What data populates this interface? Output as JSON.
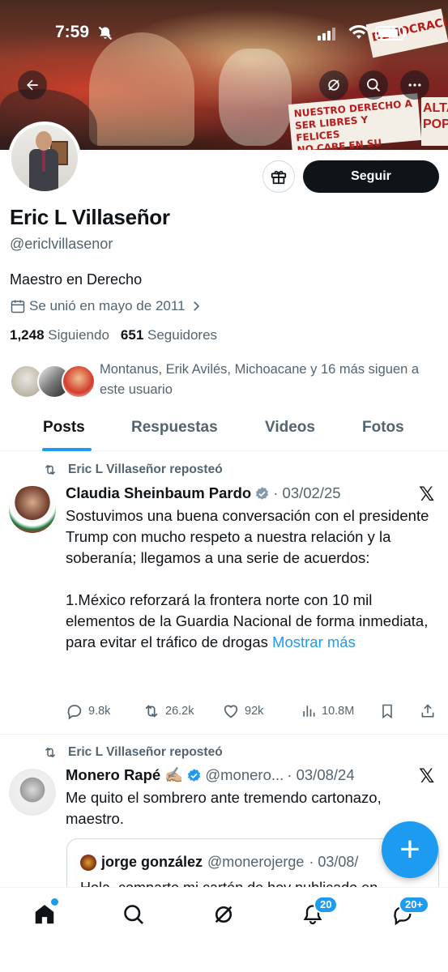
{
  "status_bar": {
    "time": "7:59"
  },
  "banner": {
    "sign_top": "DEMOCRACIA",
    "sign_main_line1": "NUESTRO DERECHO A",
    "sign_main_line2": "SER LIBRES Y FELICES",
    "sign_main_line3": "NO CABE EN SU FRAUDE",
    "sign_right": "ALTA POP"
  },
  "profile": {
    "name": "Eric L Villaseñor",
    "handle": "@ericlvillasenor",
    "bio": "Maestro en Derecho",
    "joined": "Se unió en mayo de 2011",
    "following_count": "1,248",
    "following_label": "Siguiendo",
    "followers_count": "651",
    "followers_label": "Seguidores",
    "follow_button": "Seguir",
    "known_followers": "Montanus, Erik Avilés, Michoacane y 16 más siguen a este usuario"
  },
  "tabs": [
    "Posts",
    "Respuestas",
    "Videos",
    "Fotos"
  ],
  "posts": [
    {
      "repost_label": "Eric L Villaseñor reposteó",
      "author": "Claudia Sheinbaum Pardo",
      "date": "· 03/02/25",
      "text_p1": "Sostuvimos una buena conversación con el presidente Trump con mucho respeto a nuestra relación y la soberanía; llegamos a una serie de acuerdos:",
      "text_p2": "1.México reforzará la frontera norte con 10 mil elementos de la Guardia Nacional de forma inmediata, para evitar el tráfico de drogas",
      "show_more": "Mostrar más",
      "replies": "9.8k",
      "reposts": "26.2k",
      "likes": "92k",
      "views": "10.8M"
    },
    {
      "repost_label": "Eric L Villaseñor reposteó",
      "author": "Monero Rapé ✍🏼",
      "handle": "@monero...",
      "date": "· 03/08/24",
      "text": "Me quito el sombrero ante tremendo cartonazo, maestro.",
      "quote": {
        "author": "jorge gonzález",
        "handle": "@monerojerge",
        "date": "· 03/08/",
        "text": "Hola, comparto mi cartón de hoy publicado en"
      }
    }
  ],
  "bottom_nav": {
    "notifications_badge": "20",
    "messages_badge": "20+"
  },
  "colors": {
    "accent": "#1d9bf0",
    "text": "#0f1419",
    "muted": "#536471"
  }
}
